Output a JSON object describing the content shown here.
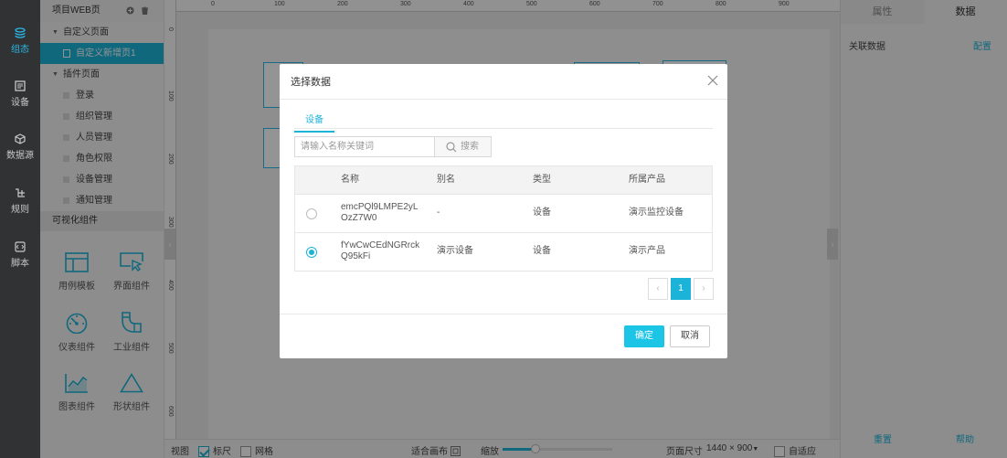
{
  "leftbar": {
    "items": [
      {
        "label": "组态",
        "icon": "layers-icon",
        "active": true
      },
      {
        "label": "设备",
        "icon": "device-icon",
        "active": false
      },
      {
        "label": "数据源",
        "icon": "cube-icon",
        "active": false
      },
      {
        "label": "规则",
        "icon": "rule-icon",
        "active": false
      },
      {
        "label": "脚本",
        "icon": "script-icon",
        "active": false
      }
    ]
  },
  "tree": {
    "title": "项目WEB页",
    "custom_group": "自定义页面",
    "custom_page": "自定义新增页1",
    "plugin_group": "插件页面",
    "plugin_pages": [
      "登录",
      "组织管理",
      "人员管理",
      "角色权限",
      "设备管理",
      "通知管理"
    ]
  },
  "components": {
    "title": "可视化组件",
    "items": [
      "用例模板",
      "界面组件",
      "仪表组件",
      "工业组件",
      "图表组件",
      "形状组件"
    ]
  },
  "ruler": {
    "top": [
      "0",
      "100",
      "200",
      "300",
      "400",
      "500",
      "600",
      "700",
      "800",
      "900"
    ],
    "left": [
      "0",
      "100",
      "200",
      "300",
      "400",
      "500",
      "600"
    ]
  },
  "bottombar": {
    "view": "视图",
    "ruler": "标尺",
    "ruler_checked": true,
    "grid": "网格",
    "grid_checked": false,
    "fit": "适合画布",
    "zoom": "缩放",
    "zoom_level": 0.3,
    "page_size_label": "页面尺寸",
    "page_size": "1440 × 900",
    "adaptive": "自适应"
  },
  "rightpanel": {
    "tab_props": "属性",
    "tab_data": "数据",
    "related_data": "关联数据",
    "configure": "配置",
    "reset": "重置",
    "help": "帮助"
  },
  "dialog": {
    "title": "选择数据",
    "tab": "设备",
    "search_placeholder": "请输入名称关键词",
    "search_button": "搜索",
    "columns": [
      "名称",
      "别名",
      "类型",
      "所属产品"
    ],
    "rows": [
      {
        "name1": "emcPQl9LMPE2yL",
        "name2": "OzZ7W0",
        "alias": "-",
        "type": "设备",
        "product": "演示监控设备",
        "selected": false
      },
      {
        "name1": "fYwCwCEdNGRrck",
        "name2": "Q95kFi",
        "alias": "演示设备",
        "type": "设备",
        "product": "演示产品",
        "selected": true
      }
    ],
    "page": "1",
    "ok": "确定",
    "cancel": "取消"
  },
  "colors": {
    "accent": "#1cb3d8",
    "sidebar": "#303233"
  }
}
